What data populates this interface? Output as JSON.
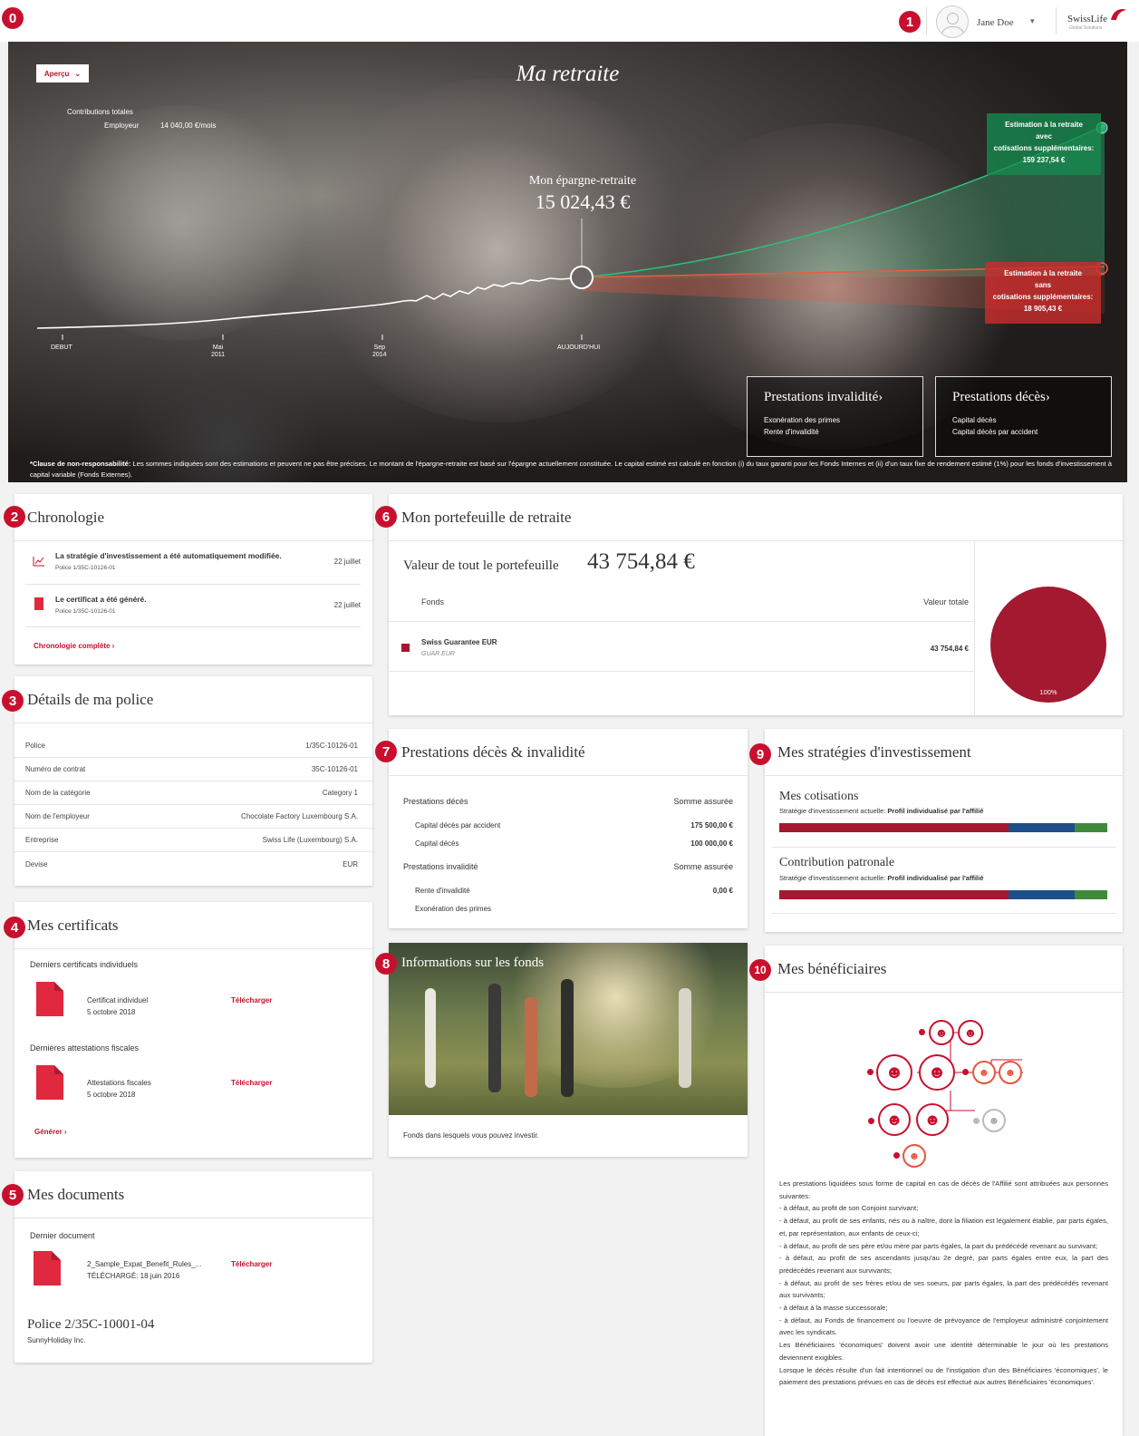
{
  "markers": [
    "0",
    "1",
    "2",
    "3",
    "4",
    "5",
    "6",
    "7",
    "8",
    "9",
    "10"
  ],
  "header": {
    "user_name": "Jane Doe",
    "brand": "SwissLife",
    "brand_sub": "Global Solutions"
  },
  "hero": {
    "view_select": "Aperçu",
    "title": "Ma retraite",
    "contrib_label": "Contributions totales",
    "employer_label": "Employeur",
    "employer_value": "14 040,00 €/mois",
    "savings_label": "Mon épargne-retraite",
    "savings_value": "15 024,43 €",
    "timeline": {
      "start": "DEBUT",
      "m1": "Mai",
      "y1": "2011",
      "m2": "Sep",
      "y2": "2014",
      "today": "AUJOURD'HUI"
    },
    "est_with": {
      "l1": "Estimation à la retraite",
      "l2": "avec",
      "l3": "cotisations supplémentaires:",
      "value": "159 237,54 €"
    },
    "est_without": {
      "l1": "Estimation à la retraite",
      "l2": "sans",
      "l3": "cotisations supplémentaires:",
      "value": "18 905,43 €"
    },
    "invalidity": {
      "title": "Prestations invalidité",
      "i1": "Exonération des primes",
      "i2": "Rente d'invalidité"
    },
    "death": {
      "title": "Prestations décès",
      "i1": "Capital décès",
      "i2": "Capital décès par accident"
    },
    "disclaimer_bold": "*Clause de non-responsabilité:",
    "disclaimer_text": " Les sommes indiquées sont des estimations et peuvent ne pas être précises. Le montant de l'épargne-retraite est basé sur l'épargne actuellement constituée. Le capital estimé est calculé en fonction (i) du taux garanti pour les Fonds Internes et (ii) d'un taux fixe de rendement estimé (1%) pour les fonds d'investissement à capital variable (Fonds Externes)."
  },
  "chronologie": {
    "title": "Chronologie",
    "items": [
      {
        "text": "La stratégie d'investissement a été automatiquement modifiée.",
        "sub": "Police 1/35C-10126-01",
        "date": "22 juillet"
      },
      {
        "text": "Le certificat a été généré.",
        "sub": "Police 1/35C-10126-01",
        "date": "22 juillet"
      }
    ],
    "link": "Chronologie complète"
  },
  "police": {
    "title": "Détails de ma police",
    "rows": [
      {
        "k": "Police",
        "v": "1/35C-10126-01"
      },
      {
        "k": "Numéro de contrat",
        "v": "35C-10126-01"
      },
      {
        "k": "Nom de la catégorie",
        "v": "Category 1"
      },
      {
        "k": "Nom de l'employeur",
        "v": "Chocolate Factory Luxembourg S.A."
      },
      {
        "k": "Entreprise",
        "v": "Swiss Life (Luxembourg) S.A."
      },
      {
        "k": "Devise",
        "v": "EUR"
      }
    ]
  },
  "certificats": {
    "title": "Mes certificats",
    "sec1": "Derniers certificats individuels",
    "c1_name": "Certificat individuel",
    "c1_date": "5 octobre 2018",
    "sec2": "Dernières attestations fiscales",
    "c2_name": "Attestations fiscales",
    "c2_date": "5 octobre 2018",
    "download": "Télécharger",
    "generate": "Générer"
  },
  "documents": {
    "title": "Mes documents",
    "sec": "Dernier document",
    "doc_name": "2_Sample_Expat_Benefit_Rules_...",
    "doc_date": "TÉLÉCHARGÉ: 18 juin 2016",
    "download": "Télécharger",
    "police2": "Police 2/35C-10001-04",
    "company": "SunnyHoliday Inc."
  },
  "portefeuille": {
    "title": "Mon portefeuille de retraite",
    "value_label": "Valeur de tout le portefeuille",
    "value": "43 754,84 €",
    "col_fonds": "Fonds",
    "col_total": "Valeur totale",
    "fund_name": "Swiss Guarantee EUR",
    "fund_code": "GUAR EUR",
    "fund_value": "43 754,84 €",
    "pie_label": "100%",
    "pie_color": "#a3192f"
  },
  "prestations": {
    "title": "Prestations décès & invalidité",
    "death": "Prestations décès",
    "sum": "Somme assurée",
    "d1": "Capital décès par accident",
    "d1v": "175 500,00 €",
    "d2": "Capital décès",
    "d2v": "100 000,00 €",
    "inval": "Prestations invalidité",
    "i1": "Rente d'invalidité",
    "i1v": "0,00 €",
    "i2": "Exonération des primes"
  },
  "strategies": {
    "title": "Mes stratégies d'investissement",
    "s1": "Mes cotisations",
    "s2": "Contribution patronale",
    "label": "Stratégie d'investissement actuelle: ",
    "profile": "Profil individualisé par l'affilié",
    "alloc": [
      0.7,
      0.2,
      0.1
    ],
    "colors": [
      "#a3192f",
      "#1d4e89",
      "#3e8a3a"
    ]
  },
  "fonds": {
    "title": "Informations sur les fonds",
    "text": "Fonds dans lesquels vous pouvez investir."
  },
  "beneficiaires": {
    "title": "Mes bénéficiaires",
    "p": [
      "Les prestations liquidées sous forme de capital en cas de décès de l'Affilié sont attribuées aux personnes suivantes:",
      "- à défaut, au profit de son Conjoint survivant;",
      "- à défaut, au profit de ses enfants, nés ou à naître, dont la filiation est légalement établie, par parts égales, et, par représentation, aux enfants de ceux-ci;",
      "- à défaut, au profit de ses père et/ou mère par parts égales, la part du prédécédé revenant au survivant;",
      "- à défaut, au profit de ses ascendants jusqu'au 2e degré, par parts égales entre eux, la part des prédécédés revenant aux survivants;",
      "- à défaut, au profit de ses frères et/ou de ses soeurs, par parts égales, la part des prédécédés revenant aux survivants;",
      "- à défaut à la masse successorale;",
      "- à défaut, au Fonds de financement ou l'oeuvre de prévoyance de l'employeur administré conjointement avec les syndicats.",
      "Les Bénéficiaires 'économiques' doivent avoir une identité déterminable le jour où les prestations deviennent exigibles.",
      "Lorsque le décès résulte d'un fait intentionnel ou de l'instigation d'un des Bénéficiaires 'économiques', le paiement des prestations prévues en cas de décès est effectué aux autres Bénéficiaires 'économiques'."
    ]
  }
}
